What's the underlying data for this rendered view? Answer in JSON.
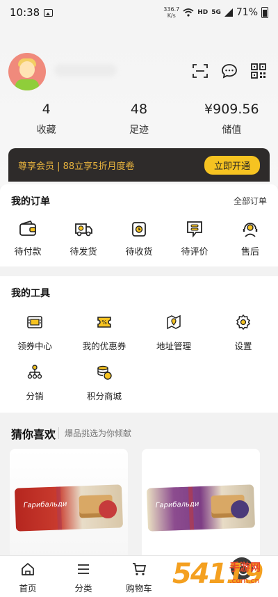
{
  "status_bar": {
    "time": "10:38",
    "net_speed_value": "336.7",
    "net_speed_unit": "K/s",
    "hd_label": "HD",
    "signal_label": "5G",
    "battery": "71%"
  },
  "header": {
    "stats": [
      {
        "value": "4",
        "label": "收藏"
      },
      {
        "value": "48",
        "label": "足迹"
      },
      {
        "value": "¥909.56",
        "label": "储值"
      }
    ]
  },
  "vip": {
    "text": "尊享会员 | 88立享5折月度卷",
    "button": "立即开通"
  },
  "orders": {
    "title": "我的订单",
    "all_link": "全部订单",
    "items": [
      {
        "label": "待付款",
        "icon": "wallet-icon"
      },
      {
        "label": "待发货",
        "icon": "delivery-truck-icon"
      },
      {
        "label": "待收货",
        "icon": "receive-box-icon"
      },
      {
        "label": "待评价",
        "icon": "review-icon"
      },
      {
        "label": "售后",
        "icon": "after-sales-icon"
      }
    ]
  },
  "tools": {
    "title": "我的工具",
    "items": [
      {
        "label": "领券中心",
        "icon": "coupon-center-icon"
      },
      {
        "label": "我的优惠券",
        "icon": "coupon-icon"
      },
      {
        "label": "地址管理",
        "icon": "address-icon"
      },
      {
        "label": "设置",
        "icon": "settings-icon"
      },
      {
        "label": "分销",
        "icon": "distribution-icon"
      },
      {
        "label": "积分商城",
        "icon": "points-mall-icon"
      }
    ]
  },
  "guess": {
    "title": "猜你喜欢",
    "subtitle": "爆品挑选为你倾献",
    "products": [
      {
        "brand": "Гарибальди"
      },
      {
        "brand": "Гарибальди"
      }
    ]
  },
  "tabbar": {
    "items": [
      {
        "label": "首页",
        "icon": "home-icon"
      },
      {
        "label": "分类",
        "icon": "category-icon"
      },
      {
        "label": "购物车",
        "icon": "cart-icon"
      }
    ]
  },
  "watermark": {
    "number": "54119",
    "site_cn": "手游网",
    "site_url": ".com.cn"
  },
  "colors": {
    "vip_bg": "#2e2b2a",
    "vip_gold": "#e8b33e",
    "button_yellow": "#f6c321"
  }
}
